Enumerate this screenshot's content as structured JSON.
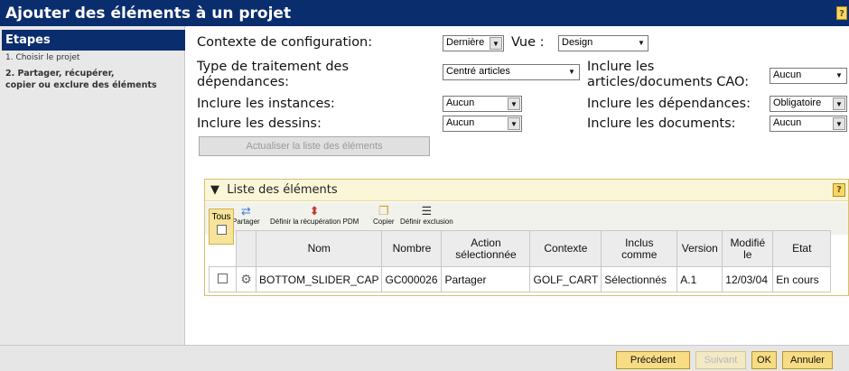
{
  "title": "Ajouter des éléments à un projet",
  "help_label": "?",
  "sidebar": {
    "header": "Etapes",
    "step1": "1. Choisir le projet",
    "step2_line1": "2. Partager, récupérer,",
    "step2_line2": "copier ou exclure des éléments"
  },
  "form": {
    "context_label": "Contexte de configuration:",
    "context_value": "Dernière",
    "vue_label": "Vue :",
    "vue_value": "Design",
    "dep_type_label_1": "Type de traitement des",
    "dep_type_label_2": "dépendances:",
    "dep_type_value": "Centré articles",
    "cad_label_1": "Inclure les",
    "cad_label_2": "articles/documents CAO:",
    "cad_value": "Aucun",
    "instances_label": "Inclure les instances:",
    "instances_value": "Aucun",
    "deps_label": "Inclure les dépendances:",
    "deps_value": "Obligatoire",
    "drawings_label": "Inclure les dessins:",
    "drawings_value": "Aucun",
    "docs_label": "Inclure les documents:",
    "docs_value": "Aucun",
    "refresh_button": "Actualiser la liste des éléments"
  },
  "list": {
    "header": "Liste des éléments",
    "tous": "Tous",
    "toolbar": [
      {
        "label": "Partager",
        "icon": "share-icon"
      },
      {
        "label": "Définir la récupération PDM",
        "icon": "pdm-retrieve-icon"
      },
      {
        "label": "Copier",
        "icon": "copy-icon"
      },
      {
        "label": "Définir exclusion",
        "icon": "exclusion-icon"
      }
    ],
    "columns": [
      "Nom",
      "Nombre",
      "Action sélectionnée",
      "Contexte",
      "Inclus comme",
      "Version",
      "Modifié le",
      "Etat"
    ],
    "rows": [
      {
        "icon": "part-gear-icon",
        "name": "BOTTOM_SLIDER_CAP",
        "number": "GC000026",
        "action": "Partager",
        "context": "GOLF_CART",
        "included_as": "Sélectionnés",
        "version": "A.1",
        "modified": "12/03/04",
        "state": "En cours"
      }
    ]
  },
  "footer": {
    "previous": "Précédent",
    "next": "Suivant",
    "ok": "OK",
    "cancel": "Annuler"
  }
}
